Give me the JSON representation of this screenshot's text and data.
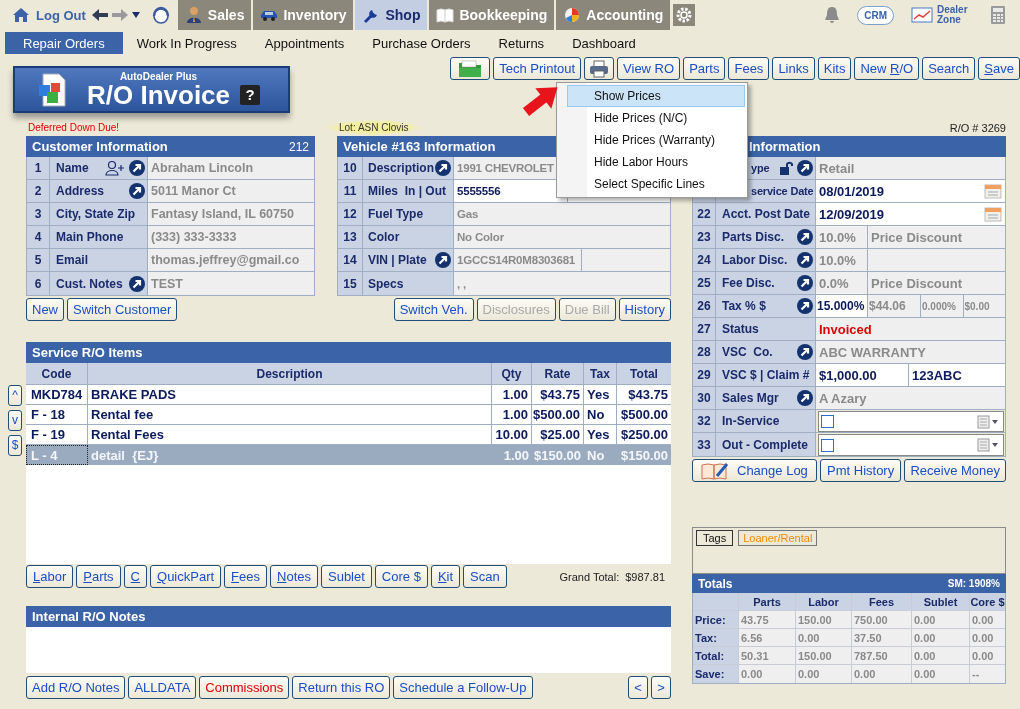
{
  "topbar": {
    "logout": "Log Out",
    "modules": [
      {
        "label": "Sales",
        "kind": "person",
        "selected": false
      },
      {
        "label": "Inventory",
        "kind": "car",
        "selected": false
      },
      {
        "label": "Shop",
        "kind": "wrench",
        "selected": true
      },
      {
        "label": "Bookkeeping",
        "kind": "book",
        "selected": false
      },
      {
        "label": "Accounting",
        "kind": "pie",
        "selected": false
      }
    ],
    "crm": "CRM",
    "dealer_zone": "Dealer Zone"
  },
  "subnav": [
    {
      "label": "Repair Orders",
      "selected": true
    },
    {
      "label": "Work In Progress",
      "selected": false
    },
    {
      "label": "Appointments",
      "selected": false
    },
    {
      "label": "Purchase Orders",
      "selected": false
    },
    {
      "label": "Returns",
      "selected": false
    },
    {
      "label": "Dashboard",
      "selected": false
    }
  ],
  "logo": {
    "brand": "AutoDealer Plus",
    "title": "R/O Invoice",
    "help": "?"
  },
  "toolbar": [
    {
      "kind": "folder"
    },
    {
      "kind": "text",
      "label": "Tech Printout"
    },
    {
      "kind": "printer"
    },
    {
      "kind": "text",
      "label": "View RO"
    },
    {
      "kind": "text",
      "label": "Parts"
    },
    {
      "kind": "text",
      "label": "Fees"
    },
    {
      "kind": "text",
      "label": "Links"
    },
    {
      "kind": "text",
      "label": "Kits"
    },
    {
      "kind": "text",
      "pre": "New ",
      "hot": "R",
      "rest": "/O"
    },
    {
      "kind": "text",
      "label": "Search"
    },
    {
      "kind": "text",
      "hot": "S",
      "rest": "ave"
    }
  ],
  "view_menu": {
    "items": [
      {
        "label": "Show Prices",
        "selected": true
      },
      {
        "label": "Hide Prices (N/C)",
        "selected": false
      },
      {
        "label": "Hide Prices (Warranty)",
        "selected": false
      },
      {
        "label": "Hide Labor Hours",
        "selected": false
      },
      {
        "label": "Select Specific Lines",
        "selected": false
      }
    ]
  },
  "customer": {
    "note": "Deferred Down Due!",
    "title": "Customer Information",
    "count": "212",
    "rows": [
      {
        "num": "1",
        "label": "Name",
        "add_person": true,
        "link": true,
        "values": [
          {
            "text": "Abraham Lincoln",
            "editable": false
          }
        ]
      },
      {
        "num": "2",
        "label": "Address",
        "link": true,
        "values": [
          {
            "text": "5011 Manor Ct",
            "editable": false
          }
        ]
      },
      {
        "num": "3",
        "label": "City, State Zip",
        "link": false,
        "values": [
          {
            "text": "Fantasy Island, IL 60750",
            "editable": false
          }
        ]
      },
      {
        "num": "4",
        "label": "Main Phone",
        "link": false,
        "values": [
          {
            "text": "(333) 333-3333",
            "editable": false
          }
        ]
      },
      {
        "num": "5",
        "label": "Email",
        "link": false,
        "values": [
          {
            "text": "thomas.jeffrey@gmail.co",
            "editable": false
          }
        ]
      },
      {
        "num": "6",
        "label": "Cust. Notes",
        "link": true,
        "values": [
          {
            "text": "TEST",
            "editable": false
          }
        ]
      }
    ],
    "buttons": [
      {
        "label": "New",
        "disabled": false
      },
      {
        "label": "Switch Customer",
        "disabled": false
      }
    ]
  },
  "vehicle": {
    "lot": "Lot: ASN Clovis",
    "title": "Vehicle #163 Information",
    "rows": [
      {
        "num": "10",
        "label": "Description",
        "link": true,
        "values": [
          {
            "text": "1991 CHEVROLET",
            "editable": false
          }
        ]
      },
      {
        "num": "11",
        "label": "Miles  In | Out",
        "link": false,
        "values": [
          {
            "text": "5555556",
            "editable": true
          },
          {
            "editable": true
          }
        ]
      },
      {
        "num": "12",
        "label": "Fuel Type",
        "link": false,
        "values": [
          {
            "text": "Gas",
            "editable": false
          }
        ]
      },
      {
        "num": "13",
        "label": "Color",
        "link": false,
        "values": [
          {
            "text": "No Color",
            "editable": false
          }
        ]
      },
      {
        "num": "14",
        "label": "VIN | Plate",
        "link": true,
        "values": [
          {
            "text": "1GCCS14R0M8303681",
            "editable": false
          },
          {
            "editable": false
          }
        ]
      },
      {
        "num": "15",
        "label": "Specs",
        "link": false,
        "values": [
          {
            "text": ", ,",
            "editable": false
          }
        ]
      }
    ],
    "buttons": [
      {
        "label": "Switch Veh.",
        "disabled": false
      },
      {
        "label": "Disclosures",
        "disabled": true
      },
      {
        "label": "Due Bill",
        "disabled": true
      },
      {
        "label": "History",
        "disabled": false
      }
    ]
  },
  "service": {
    "title": "Service R/O Items",
    "side_buttons": [
      "^",
      "v",
      "$"
    ],
    "columns": [
      "Code",
      "Description",
      "Qty",
      "Rate",
      "Tax",
      "Total"
    ],
    "rows": [
      {
        "code": "MKD784",
        "description": "BRAKE PADS",
        "qty": "1.00",
        "rate": "$43.75",
        "tax": "Yes",
        "total": "$43.75",
        "selected": false
      },
      {
        "code": "F - 18",
        "description": "Rental fee",
        "qty": "1.00",
        "rate": "$500.00",
        "tax": "No",
        "total": "$500.00",
        "selected": false
      },
      {
        "code": "F - 19",
        "description": "Rental Fees",
        "qty": "10.00",
        "rate": "$25.00",
        "tax": "Yes",
        "total": "$250.00",
        "selected": false
      },
      {
        "code": "L - 4",
        "description": "detail  {EJ}",
        "qty": "1.00",
        "rate": "$150.00",
        "tax": "No",
        "total": "$150.00",
        "selected": true
      }
    ],
    "buttons": [
      {
        "hot": "L",
        "rest": "abor"
      },
      {
        "hot": "P",
        "rest": "arts"
      },
      {
        "hot": "C"
      },
      {
        "hot": "Q",
        "rest": "uickPart"
      },
      {
        "hot": "F",
        "rest": "ees"
      },
      {
        "hot": "N",
        "rest": "otes"
      },
      {
        "label": "Sublet"
      },
      {
        "label": "Core $"
      },
      {
        "hot": "K",
        "rest": "it"
      },
      {
        "label": "Scan"
      }
    ],
    "grand_total_label": "Grand Total:",
    "grand_total": "$987.81"
  },
  "notes": {
    "title": "Internal R/O Notes",
    "buttons": [
      {
        "label": "Add R/O Notes",
        "alert": false
      },
      {
        "label": "ALLDATA",
        "alert": false
      },
      {
        "label": "Commissions",
        "alert": true
      },
      {
        "label": "Return this RO",
        "alert": false
      },
      {
        "label": "Schedule a Follow-Up",
        "alert": false
      }
    ],
    "pager": [
      "<",
      ">"
    ]
  },
  "info": {
    "ro_number": "R/O # 3269",
    "title": "Information",
    "covered": true,
    "rows": [
      {
        "kind": "text",
        "label": "ype",
        "covered": true,
        "unlock": true,
        "link": true,
        "values": [
          {
            "text": "Retail",
            "editable": false
          }
        ]
      },
      {
        "kind": "date",
        "label": "service Date",
        "covered": true,
        "link": false,
        "values": [
          {
            "text": "08/01/2019",
            "editable": true
          }
        ]
      },
      {
        "kind": "date",
        "num": "22",
        "label": "Acct. Post Date",
        "covered": false,
        "link": false,
        "values": [
          {
            "text": "12/09/2019",
            "editable": true
          }
        ]
      },
      {
        "kind": "discount",
        "num": "23",
        "label": "Parts Disc.",
        "covered": false,
        "link": true,
        "values": [
          {
            "text": "10.0%",
            "editable": false
          },
          {
            "text": "Price Discount",
            "editable": false
          }
        ]
      },
      {
        "kind": "discount",
        "num": "24",
        "label": "Labor Disc.",
        "covered": false,
        "link": true,
        "values": [
          {
            "text": "10.0%",
            "editable": false
          },
          {
            "editable": false
          }
        ]
      },
      {
        "kind": "discount",
        "num": "25",
        "label": "Fee Disc.",
        "covered": false,
        "link": true,
        "values": [
          {
            "text": "0.0%",
            "editable": false
          },
          {
            "text": "Price Discount",
            "editable": false
          }
        ]
      },
      {
        "kind": "tax",
        "num": "26",
        "label": "Tax % $",
        "covered": false,
        "link": true,
        "values": [
          {
            "text": "15.000%",
            "editable": true
          },
          {
            "text": "$44.06",
            "editable": false
          },
          {
            "text": "0.000%",
            "editable": false
          },
          {
            "text": "$0.00",
            "editable": false
          }
        ]
      },
      {
        "kind": "text",
        "num": "27",
        "label": "Status",
        "covered": false,
        "link": false,
        "values": [
          {
            "text": "Invoiced",
            "editable": false,
            "alert": true
          }
        ]
      },
      {
        "kind": "text",
        "num": "28",
        "label": "VSC  Co.",
        "covered": false,
        "link": true,
        "values": [
          {
            "text": "ABC WARRANTY",
            "editable": false
          }
        ]
      },
      {
        "kind": "text",
        "num": "29",
        "label": "VSC $ | Claim #",
        "covered": false,
        "link": false,
        "values": [
          {
            "text": "$1,000.00",
            "editable": true
          },
          {
            "text": "123ABC",
            "editable": true
          }
        ]
      },
      {
        "kind": "text",
        "num": "30",
        "label": "Sales Mgr",
        "covered": false,
        "link": true,
        "values": [
          {
            "text": "A Azary",
            "editable": false
          }
        ]
      },
      {
        "kind": "check",
        "num": "32",
        "label": "In-Service",
        "covered": false,
        "link": false,
        "checked": false
      },
      {
        "kind": "check",
        "num": "33",
        "label": "Out - Complete",
        "covered": false,
        "link": false,
        "checked": false
      }
    ],
    "buttons": [
      {
        "label": "Change Log",
        "kind": "log"
      },
      {
        "label": "Pmt History",
        "kind": "text"
      },
      {
        "label": "Receive Money",
        "kind": "text"
      }
    ]
  },
  "tags": {
    "label": "Tags",
    "items": [
      {
        "label": "Loaner/Rental",
        "color": "#f08a00"
      }
    ]
  },
  "totals": {
    "title": "Totals",
    "sm": "SM: 1908%",
    "columns": [
      "Parts",
      "Labor",
      "Fees",
      "Sublet",
      "Core $"
    ],
    "rows": [
      {
        "label": "Price:",
        "values": [
          "43.75",
          "150.00",
          "750.00",
          "0.00",
          "0.00"
        ]
      },
      {
        "label": "Tax:",
        "values": [
          "6.56",
          "0.00",
          "37.50",
          "0.00",
          "0.00"
        ]
      },
      {
        "label": "Total:",
        "values": [
          "50.31",
          "150.00",
          "787.50",
          "0.00",
          "0.00"
        ]
      },
      {
        "label": "Save:",
        "values": [
          "0.00",
          "0.00",
          "0.00",
          "0.00",
          "--"
        ]
      }
    ]
  }
}
